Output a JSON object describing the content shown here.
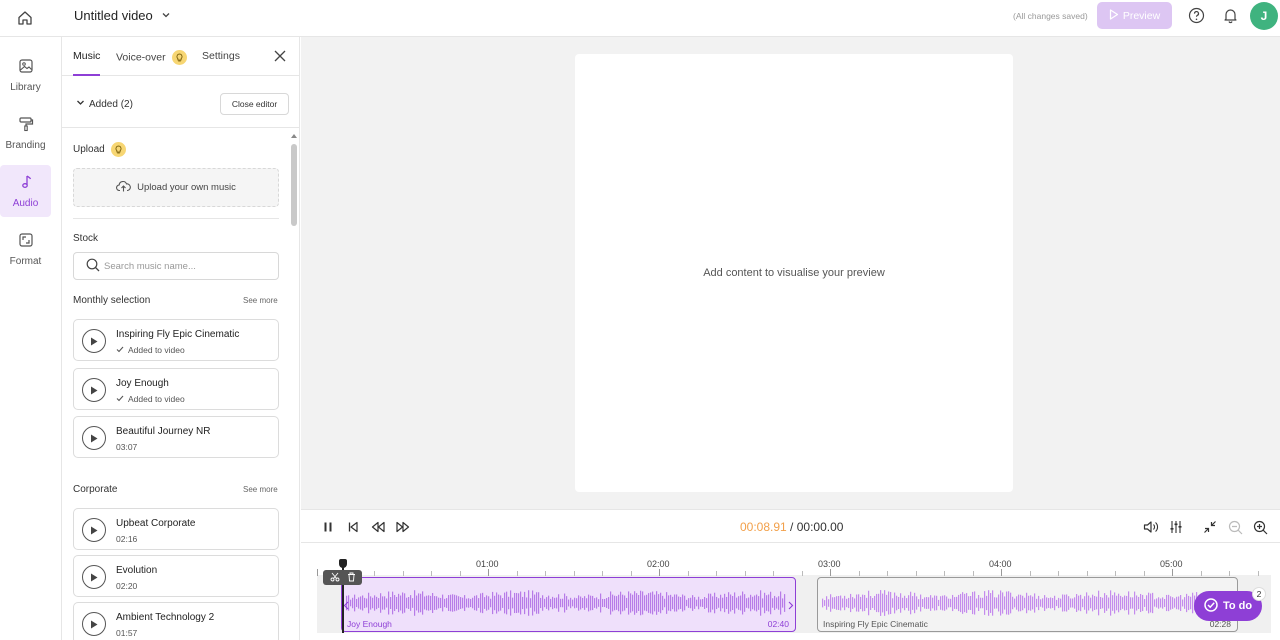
{
  "colors": {
    "accent": "#8e3fd6",
    "accent_soft": "#efe0fb",
    "preview_button": "#ddc6f3",
    "avatar": "#3fb37f",
    "time_current": "#f2a04a",
    "bulb": "#f7d673"
  },
  "topbar": {
    "home_icon": "home-icon",
    "title": "Untitled video",
    "saved_status": "(All changes saved)",
    "preview_label": "Preview",
    "avatar_initial": "J"
  },
  "rail": {
    "items": [
      {
        "label": "Library",
        "icon": "image-icon"
      },
      {
        "label": "Branding",
        "icon": "paint-roller-icon"
      },
      {
        "label": "Audio",
        "icon": "music-note-icon",
        "active": true
      },
      {
        "label": "Format",
        "icon": "resize-icon"
      }
    ]
  },
  "panel": {
    "tabs": [
      "Music",
      "Voice-over",
      "Settings"
    ],
    "added_label": "Added (2)",
    "close_editor_label": "Close editor",
    "upload": {
      "label": "Upload",
      "button_label": "Upload your own music"
    },
    "stock": {
      "label": "Stock",
      "search_placeholder": "Search music name..."
    },
    "sections": [
      {
        "title": "Monthly selection",
        "see_more": "See more",
        "tracks": [
          {
            "name": "Inspiring Fly Epic Cinematic",
            "sub": "Added to video",
            "added": true
          },
          {
            "name": "Joy Enough",
            "sub": "Added to video",
            "added": true
          },
          {
            "name": "Beautiful Journey NR",
            "sub": "03:07",
            "added": false
          }
        ]
      },
      {
        "title": "Corporate",
        "see_more": "See more",
        "tracks": [
          {
            "name": "Upbeat Corporate",
            "sub": "02:16",
            "added": false
          },
          {
            "name": "Evolution",
            "sub": "02:20",
            "added": false
          },
          {
            "name": "Ambient Technology 2",
            "sub": "01:57",
            "added": false
          }
        ]
      }
    ]
  },
  "stage": {
    "empty_message": "Add content to visualise your preview"
  },
  "controls": {
    "current_time": "00:08.91",
    "separator": " / ",
    "total_time": "00:00.00"
  },
  "timeline": {
    "ticks": [
      "01:00",
      "02:00",
      "03:00",
      "04:00",
      "05:00"
    ],
    "clips": [
      {
        "name": "Joy Enough",
        "duration": "02:40"
      },
      {
        "name": "Inspiring Fly Epic Cinematic",
        "duration": "02:28"
      }
    ]
  },
  "todo": {
    "label": "To do",
    "count": "2"
  }
}
